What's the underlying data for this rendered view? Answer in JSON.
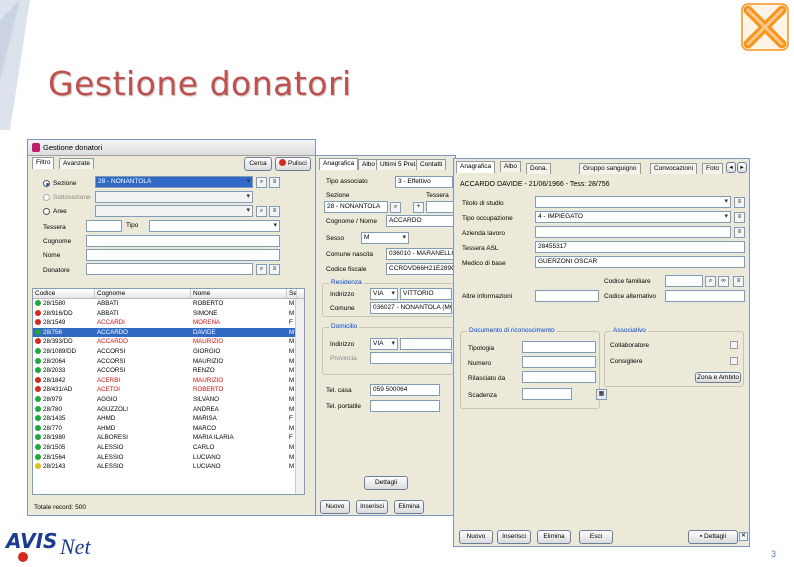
{
  "slide": {
    "title": "Gestione donatori",
    "page_number": "3"
  },
  "logo": {
    "text": "Net",
    "brand": "AVIS"
  },
  "colors": {
    "title": "#c0504d",
    "selection": "#316ac5",
    "accent_orange": "#f7941d"
  },
  "win1": {
    "title": "Gestione donatori",
    "tabs": [
      "Filtro",
      "Avanzate"
    ],
    "cerca": "Cerca",
    "pulisci": "Pulisci",
    "sezione_label": "Sezione",
    "sezione_value": "28 - NONANTOLA",
    "sottosezione_label": "Sottosezione",
    "aree_label": "Aree",
    "tessera_label": "Tessera",
    "tipo_label": "Tipo",
    "cognome_label": "Cognome",
    "nome_label": "Nome",
    "donatore_label": "Donatore",
    "columns": [
      "Codice",
      "Cognome",
      "Nome",
      "Se"
    ],
    "rows": [
      {
        "codice": "28/1580",
        "cognome": "ABBATI",
        "nome": "ROBERTO",
        "sesso": "M",
        "status": "green",
        "red": false
      },
      {
        "codice": "28/916/DD",
        "cognome": "ABBATI",
        "nome": "SIMONE",
        "sesso": "M",
        "status": "red",
        "red": false
      },
      {
        "codice": "28/1549",
        "cognome": "ACCARDI",
        "nome": "MORENA",
        "sesso": "F",
        "status": "red",
        "red": true
      },
      {
        "codice": "28/756",
        "cognome": "ACCARDO",
        "nome": "DAVIDE",
        "sesso": "M",
        "status": "green",
        "red": false,
        "selected": true
      },
      {
        "codice": "28/393/DD",
        "cognome": "ACCARDO",
        "nome": "MAURIZIO",
        "sesso": "M",
        "status": "red",
        "red": true
      },
      {
        "codice": "28/1089/DD",
        "cognome": "ACCORSI",
        "nome": "GIORGIO",
        "sesso": "M",
        "status": "green",
        "red": false
      },
      {
        "codice": "28/2064",
        "cognome": "ACCORSI",
        "nome": "MAURIZIO",
        "sesso": "M",
        "status": "green",
        "red": false
      },
      {
        "codice": "28/2033",
        "cognome": "ACCORSI",
        "nome": "RENZO",
        "sesso": "M",
        "status": "green",
        "red": false
      },
      {
        "codice": "28/1842",
        "cognome": "ACERBI",
        "nome": "MAURIZIO",
        "sesso": "M",
        "status": "red",
        "red": true
      },
      {
        "codice": "28/431/AD",
        "cognome": "ACETOI",
        "nome": "ROBERTO",
        "sesso": "M",
        "status": "red",
        "red": true
      },
      {
        "codice": "28/979",
        "cognome": "AGGIO",
        "nome": "SILVANO",
        "sesso": "M",
        "status": "green",
        "red": false
      },
      {
        "codice": "28/780",
        "cognome": "AGUZZOLI",
        "nome": "ANDREA",
        "sesso": "M",
        "status": "green",
        "red": false
      },
      {
        "codice": "28/1435",
        "cognome": "AHMD",
        "nome": "MARISA",
        "sesso": "F",
        "status": "green",
        "red": false
      },
      {
        "codice": "28/770",
        "cognome": "AHMD",
        "nome": "MARCO",
        "sesso": "M",
        "status": "green",
        "red": false
      },
      {
        "codice": "28/1980",
        "cognome": "ALBORESI",
        "nome": "MARIA ILARIA",
        "sesso": "F",
        "status": "green",
        "red": false
      },
      {
        "codice": "28/1505",
        "cognome": "ALESSIO",
        "nome": "CARLO",
        "sesso": "M",
        "status": "green",
        "red": false
      },
      {
        "codice": "28/1564",
        "cognome": "ALESSIO",
        "nome": "LUCIANO",
        "sesso": "M",
        "status": "green",
        "red": false
      },
      {
        "codice": "28/2143",
        "cognome": "ALESSIO",
        "nome": "LUCIANO",
        "sesso": "M",
        "status": "yellow",
        "red": false
      }
    ],
    "totale": "Totale record: 500"
  },
  "win2": {
    "tabs": [
      "Anagrafica",
      "Albo",
      "Ultimi 5 Prel.",
      "Contatti"
    ],
    "tipo_associato_label": "Tipo associato",
    "tipo_associato_value": "3 - Effettivo",
    "sezione_label": "Sezione",
    "tessera_label": "Tessera",
    "sezione_value": "28 - NONANTOLA",
    "cognome_nome_label": "Cognome / Nome",
    "cognome_value": "ACCARDO",
    "sesso_label": "Sesso",
    "sesso_value": "M",
    "comune_nascita_label": "Comune nascita",
    "comune_nascita_value": "036010 - MARANELLO",
    "codice_fiscale_label": "Codice fiscale",
    "codice_fiscale_value": "CCRDVD66H21E289G",
    "residenza_title": "Residenza",
    "indirizzo_label": "Indirizzo",
    "via_value": "VIA",
    "vittorio_value": "VITTORIO",
    "comune_label": "Comune",
    "comune_value": "036027 - NONANTOLA (MO)",
    "domicilio_title": "Domicilio",
    "provincia_label": "Provincia",
    "telcasa_label": "Tel. casa",
    "telcasa_value": "059 500064",
    "telportatile_label": "Tel. portatile",
    "nuovo": "Nuovo",
    "inserisci": "Inserisci",
    "elimina": "Elimina",
    "dettagli": "Dettagli"
  },
  "win3": {
    "tabs": [
      "Anagrafica",
      "Albo",
      "Dona.",
      "Gruppo sanguigno",
      "Convocazioni",
      "Foto"
    ],
    "header": "ACCARDO DAVIDE - 21/06/1966 - Tess: 28/756",
    "titolo_studio_label": "Titolo di studio",
    "tipo_occupazione_label": "Tipo occupazione",
    "tipo_occupazione_value": "4 - IMPIEGATO",
    "azienda_label": "Azienda lavoro",
    "tessera_asl_label": "Tessera ASL",
    "tessera_asl_value": "28455317",
    "medico_label": "Medico di base",
    "medico_value": "GUERZONI OSCAR",
    "codice_familiare_label": "Codice familiare",
    "altre_info_label": "Altre informazioni",
    "codice_alternativo_label": "Codice alternativo",
    "documento_title": "Documento di riconoscimento",
    "tipologia_label": "Tipologia",
    "numero_label": "Numero",
    "rilasciato_label": "Rilasciato da",
    "scadenza_label": "Scadenza",
    "associativo_title": "Associativo",
    "collaboratore_label": "Collaboratore",
    "consigliere_label": "Consigliere",
    "zona_button": "Zona e Ambito",
    "nuovo": "Nuovo",
    "inserisci": "Inserisci",
    "elimina": "Elimina",
    "esci": "Esci",
    "dettagli": "Dettagli"
  }
}
